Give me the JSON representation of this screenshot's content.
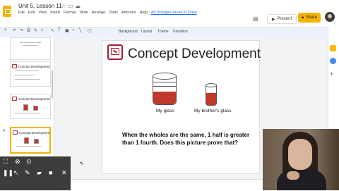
{
  "header": {
    "title": "Unit 5, Lesson 11",
    "menu": [
      "File",
      "Edit",
      "View",
      "Insert",
      "Format",
      "Slide",
      "Arrange",
      "Tools",
      "Add-ons",
      "Help"
    ],
    "last_edit": "All changes saved in Drive",
    "present_label": "Present",
    "share_label": "Share"
  },
  "toolbar": {
    "background": "Background",
    "layout": "Layout",
    "theme": "Theme",
    "transition": "Transition"
  },
  "filmstrip": {
    "slides": [
      {
        "num": "",
        "title": ""
      },
      {
        "num": "",
        "title": "Concept Development"
      },
      {
        "num": "",
        "title": "Concept Development"
      },
      {
        "num": "8",
        "title": "Concept Development"
      }
    ]
  },
  "slide": {
    "title": "Concept Development",
    "glass1_label": "My glass",
    "glass2_label": "My brother's glass",
    "body_text": "When the wholes are the same, 1 half is greater than 1 fourth.  Does this picture prove that?",
    "glass1_fill": 0.45,
    "glass2_fill": 0.62
  },
  "colors": {
    "accent": "#f4b400",
    "fill": "#c0392b",
    "icon": "#a61c2b"
  }
}
